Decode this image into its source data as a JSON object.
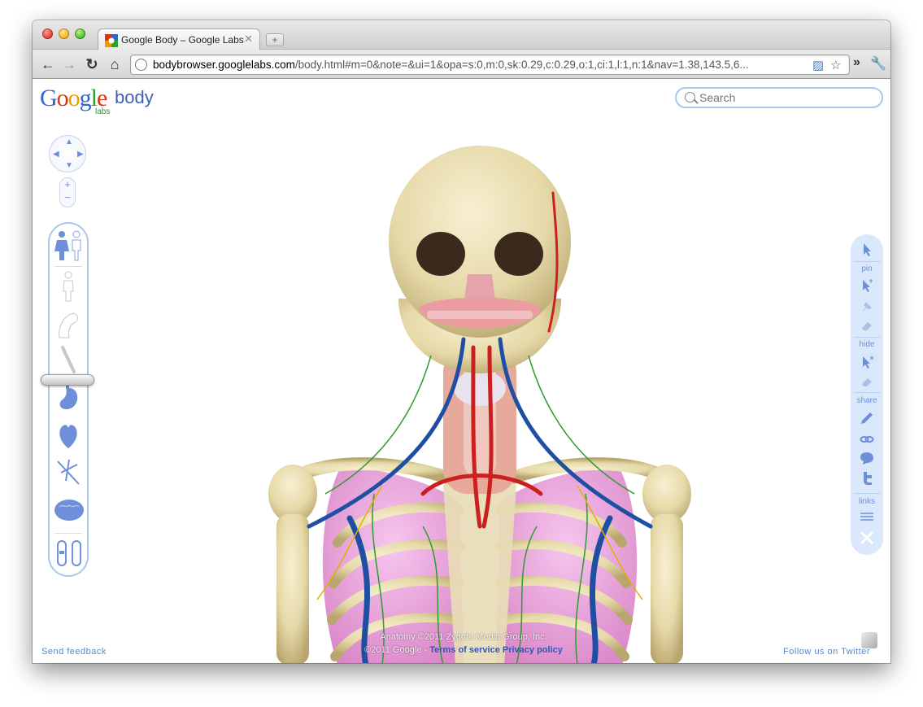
{
  "window": {
    "tab_title": "Google Body – Google Labs",
    "url_host": "bodybrowser.googlelabs.com",
    "url_path": "/body.html#m=0&note=&ui=1&opa=s:0,m:0,sk:0.29,c:0.29,o:1,ci:1,l:1,n:1&nav=1.38,143.5,6..."
  },
  "header": {
    "logo_letters": [
      "G",
      "o",
      "o",
      "g",
      "l",
      "e"
    ],
    "logo_colors": [
      "#3366cc",
      "#dd3311",
      "#ee9900",
      "#3366cc",
      "#22aa22",
      "#dd3311"
    ],
    "logo_suffix": "body",
    "logo_labs": "labs",
    "search_placeholder": "Search"
  },
  "left_controls": {
    "zoom_in": "+",
    "zoom_out": "−",
    "layers": [
      "skin-female-icon",
      "skin-icon",
      "muscle-icon",
      "bone-icon",
      "stomach-icon",
      "heart-icon",
      "nerves-icon",
      "brain-icon",
      "toggle-icon"
    ],
    "slider_level": 0.47
  },
  "right_toolbar": {
    "pin_label": "pin",
    "hide_label": "hide",
    "share_label": "share",
    "links_label": "links"
  },
  "footer": {
    "feedback": "Send feedback",
    "follow": "Follow us on Twitter",
    "credit_line1": "Anatomy ©2011 Zygote Media Group, Inc.",
    "credit_line2_prefix": "©2011 Google -",
    "terms": "Terms of service",
    "privacy": "Privacy policy"
  },
  "colors": {
    "accent": "#6f8fd8",
    "panel_border": "#a7c7f0",
    "panel_bg": "#d9e8fb"
  }
}
